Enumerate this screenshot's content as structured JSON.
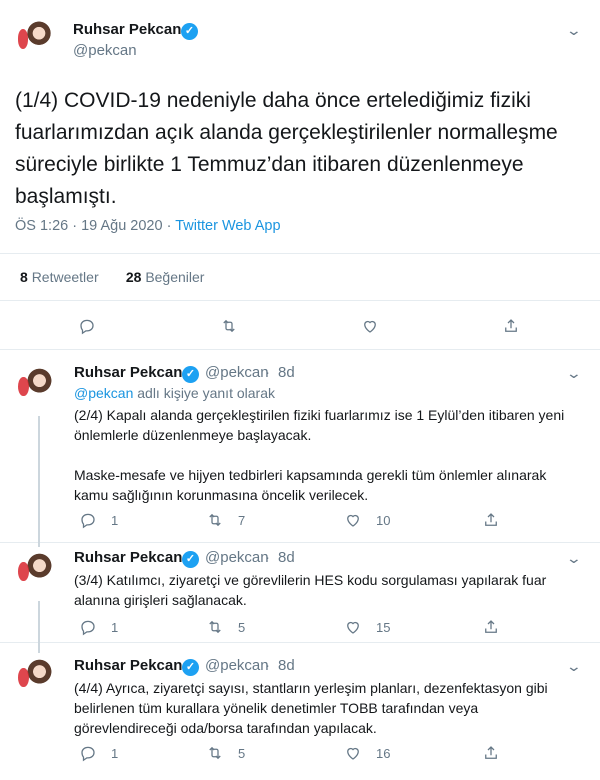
{
  "main_tweet": {
    "name": "Ruhsar Pekcan",
    "handle": "@pekcan",
    "text": "(1/4) COVID-19 nedeniyle daha önce ertelediğimiz fiziki fuarlarımızdan açık alanda gerçekleştirilenler normalleşme süreciyle birlikte 1 Temmuz’dan itibaren düzenlenmeye başlamıştı.",
    "time": "ÖS 1:26",
    "date": "19 Ağu 2020",
    "separator": "·",
    "app": "Twitter Web App",
    "retweets_count": "8",
    "retweets_label": "Retweetler",
    "likes_count": "28",
    "likes_label": "Beğeniler"
  },
  "replies": [
    {
      "name": "Ruhsar Pekcan",
      "handle": "@pekcan",
      "age": "8d",
      "reply_to_mention": "@pekcan",
      "reply_to_suffix": "adlı kişiye yanıt olarak",
      "text1": "(2/4) Kapalı alanda gerçekleştirilen fiziki fuarlarımız ise 1 Eylül’den itibaren yeni önlemlerle düzenlenmeye başlayacak.",
      "text2": "Maske-mesafe ve hijyen tedbirleri kapsamında gerekli tüm önlemler alınarak kamu sağlığının korunmasına öncelik verilecek.",
      "replies": "1",
      "retweets": "7",
      "likes": "10"
    },
    {
      "name": "Ruhsar Pekcan",
      "handle": "@pekcan",
      "age": "8d",
      "text1": "(3/4) Katılımcı, ziyaretçi ve görevlilerin HES kodu sorgulaması yapılarak fuar alanına girişleri sağlanacak.",
      "replies": "1",
      "retweets": "5",
      "likes": "15"
    },
    {
      "name": "Ruhsar Pekcan",
      "handle": "@pekcan",
      "age": "8d",
      "text1": "(4/4) Ayrıca, ziyaretçi sayısı, stantların yerleşim planları, dezenfektasyon gibi belirlenen tüm kurallara yönelik denetimler TOBB tarafından veya görevlendireceği oda/borsa tarafından yapılacak.",
      "replies": "1",
      "retweets": "5",
      "likes": "16"
    }
  ],
  "colors": {
    "link": "#1b95e0",
    "verified": "#1da1f2",
    "muted": "#657786",
    "divider": "#e6ecf0"
  },
  "icons": [
    "verified-badge-icon",
    "chevron-down-icon",
    "reply-icon",
    "retweet-icon",
    "like-icon",
    "share-icon"
  ]
}
